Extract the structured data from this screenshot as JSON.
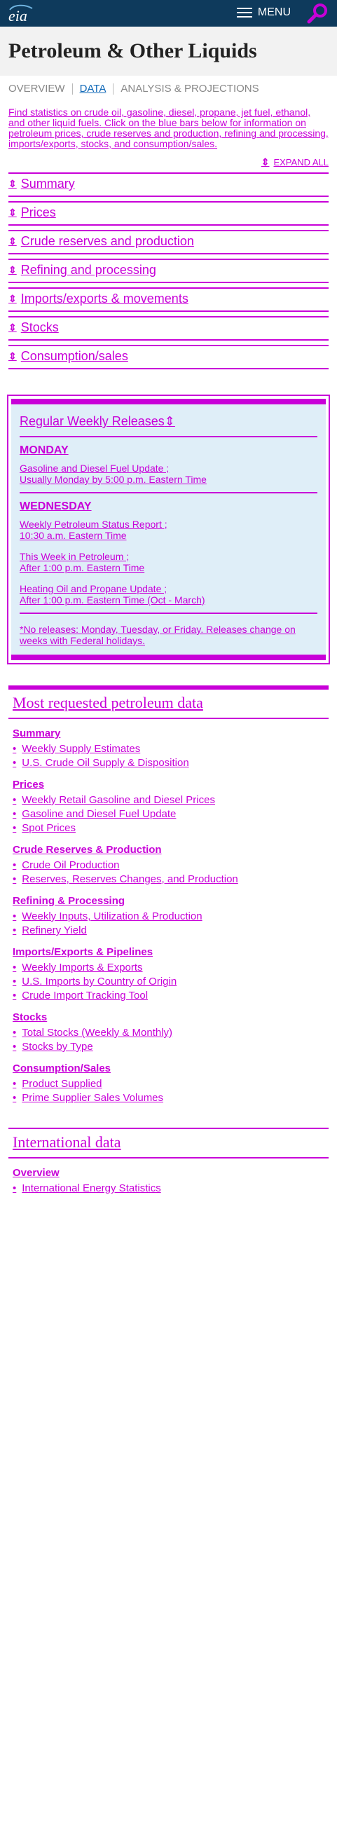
{
  "header": {
    "logo_text": "eia",
    "menu_label": "MENU"
  },
  "page": {
    "title": "Petroleum & Other Liquids"
  },
  "tabs": [
    {
      "label": "OVERVIEW"
    },
    {
      "label": "DATA"
    },
    {
      "label": "ANALYSIS & PROJECTIONS"
    }
  ],
  "intro": "Find statistics on crude oil, gasoline, diesel, propane, jet fuel, ethanol, and other liquid fuels. Click on the blue bars below for information on petroleum prices, crude reserves and production, refining and processing, imports/exports, stocks, and consumption/sales.",
  "expand_all": "EXPAND ALL",
  "accordion": [
    {
      "label": "Summary"
    },
    {
      "label": "Prices"
    },
    {
      "label": "Crude reserves and production"
    },
    {
      "label": "Refining and processing"
    },
    {
      "label": "Imports/exports & movements"
    },
    {
      "label": "Stocks"
    },
    {
      "label": "Consumption/sales"
    }
  ],
  "weekly": {
    "title": "Regular Weekly Releases",
    "monday": {
      "day": "MONDAY",
      "releases": [
        {
          "name": "Gasoline and Diesel Fuel Update ;",
          "time": "Usually Monday by 5:00 p.m. Eastern Time"
        }
      ]
    },
    "wednesday": {
      "day": "WEDNESDAY",
      "releases": [
        {
          "name": "Weekly Petroleum Status Report ;",
          "time": "10:30 a.m. Eastern Time"
        },
        {
          "name": "This Week in Petroleum ;",
          "time": "After 1:00 p.m. Eastern Time"
        },
        {
          "name": "Heating Oil and Propane Update ;",
          "time": "After 1:00 p.m. Eastern Time (Oct - March)"
        }
      ]
    },
    "note": "*No releases: Monday, Tuesday, or Friday. Releases change on weeks with Federal holidays."
  },
  "most_requested": {
    "title": "Most requested petroleum data",
    "groups": [
      {
        "title": "Summary",
        "items": [
          "Weekly Supply Estimates",
          "U.S. Crude Oil Supply & Disposition"
        ]
      },
      {
        "title": "Prices",
        "items": [
          "Weekly Retail Gasoline and Diesel Prices",
          "Gasoline and Diesel Fuel Update",
          "Spot Prices"
        ]
      },
      {
        "title": "Crude Reserves & Production",
        "items": [
          "Crude Oil Production",
          "Reserves, Reserves Changes, and Production"
        ]
      },
      {
        "title": "Refining & Processing",
        "items": [
          "Weekly Inputs, Utilization & Production",
          "Refinery Yield"
        ]
      },
      {
        "title": "Imports/Exports & Pipelines",
        "items": [
          "Weekly Imports & Exports",
          "U.S. Imports by Country of Origin",
          "Crude Import Tracking Tool"
        ]
      },
      {
        "title": "Stocks",
        "items": [
          "Total Stocks (Weekly & Monthly)",
          "Stocks by Type"
        ]
      },
      {
        "title": "Consumption/Sales",
        "items": [
          "Product Supplied",
          "Prime Supplier Sales Volumes"
        ]
      }
    ]
  },
  "international": {
    "title": "International data",
    "groups": [
      {
        "title": "Overview",
        "items": [
          "International Energy Statistics"
        ]
      }
    ]
  },
  "colors": {
    "header_bg": "#0e3a5c",
    "accent": "#c800d8",
    "active_tab": "#0f68b7",
    "weekly_bg": "#dfeef8"
  }
}
